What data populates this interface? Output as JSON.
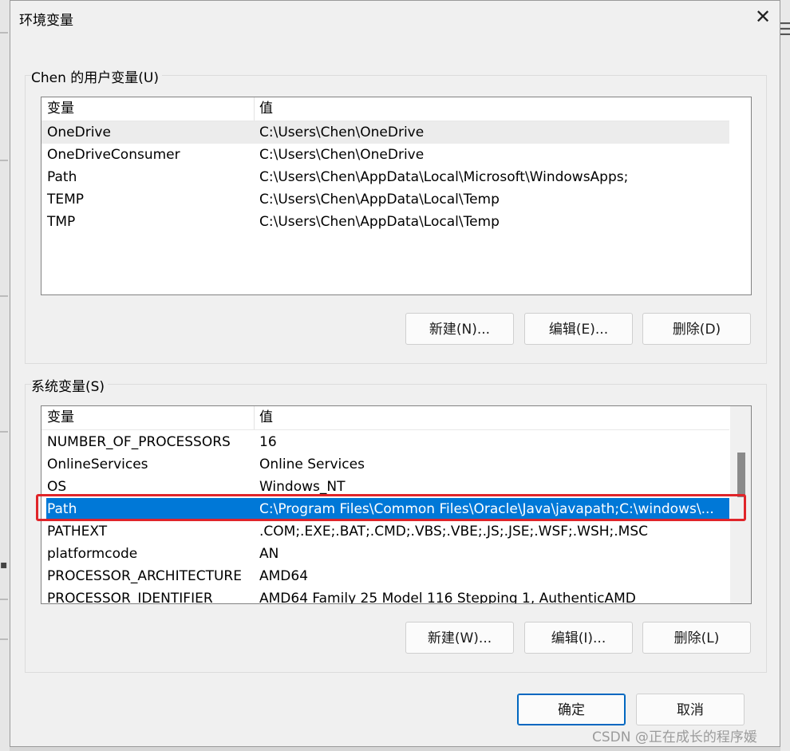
{
  "title": "环境变量",
  "user_group": {
    "label": "Chen 的用户变量(U)",
    "columns": [
      "变量",
      "值"
    ],
    "rows": [
      {
        "name": "OneDrive",
        "value": "C:\\Users\\Chen\\OneDrive"
      },
      {
        "name": "OneDriveConsumer",
        "value": "C:\\Users\\Chen\\OneDrive"
      },
      {
        "name": "Path",
        "value": "C:\\Users\\Chen\\AppData\\Local\\Microsoft\\WindowsApps;"
      },
      {
        "name": "TEMP",
        "value": "C:\\Users\\Chen\\AppData\\Local\\Temp"
      },
      {
        "name": "TMP",
        "value": "C:\\Users\\Chen\\AppData\\Local\\Temp"
      }
    ],
    "buttons": {
      "new": "新建(N)...",
      "edit": "编辑(E)...",
      "delete": "删除(D)"
    }
  },
  "system_group": {
    "label": "系统变量(S)",
    "columns": [
      "变量",
      "值"
    ],
    "rows": [
      {
        "name": "NUMBER_OF_PROCESSORS",
        "value": "16"
      },
      {
        "name": "OnlineServices",
        "value": "Online Services"
      },
      {
        "name": "OS",
        "value": "Windows_NT"
      },
      {
        "name": "Path",
        "value": "C:\\Program Files\\Common Files\\Oracle\\Java\\javapath;C:\\windows\\..."
      },
      {
        "name": "PATHEXT",
        "value": ".COM;.EXE;.BAT;.CMD;.VBS;.VBE;.JS;.JSE;.WSF;.WSH;.MSC"
      },
      {
        "name": "platformcode",
        "value": "AN"
      },
      {
        "name": "PROCESSOR_ARCHITECTURE",
        "value": "AMD64"
      },
      {
        "name": "PROCESSOR_IDENTIFIER",
        "value": "AMD64 Family 25 Model 116 Stepping 1, AuthenticAMD"
      }
    ],
    "selected_row": "Path",
    "buttons": {
      "new": "新建(W)...",
      "edit": "编辑(I)...",
      "delete": "删除(L)"
    }
  },
  "footer": {
    "ok": "确定",
    "cancel": "取消"
  },
  "watermark": "CSDN @正在成长的程序媛",
  "colors": {
    "selection": "#0078d7",
    "highlight_box": "#e0252a"
  },
  "icons": {
    "close": "close-icon"
  }
}
